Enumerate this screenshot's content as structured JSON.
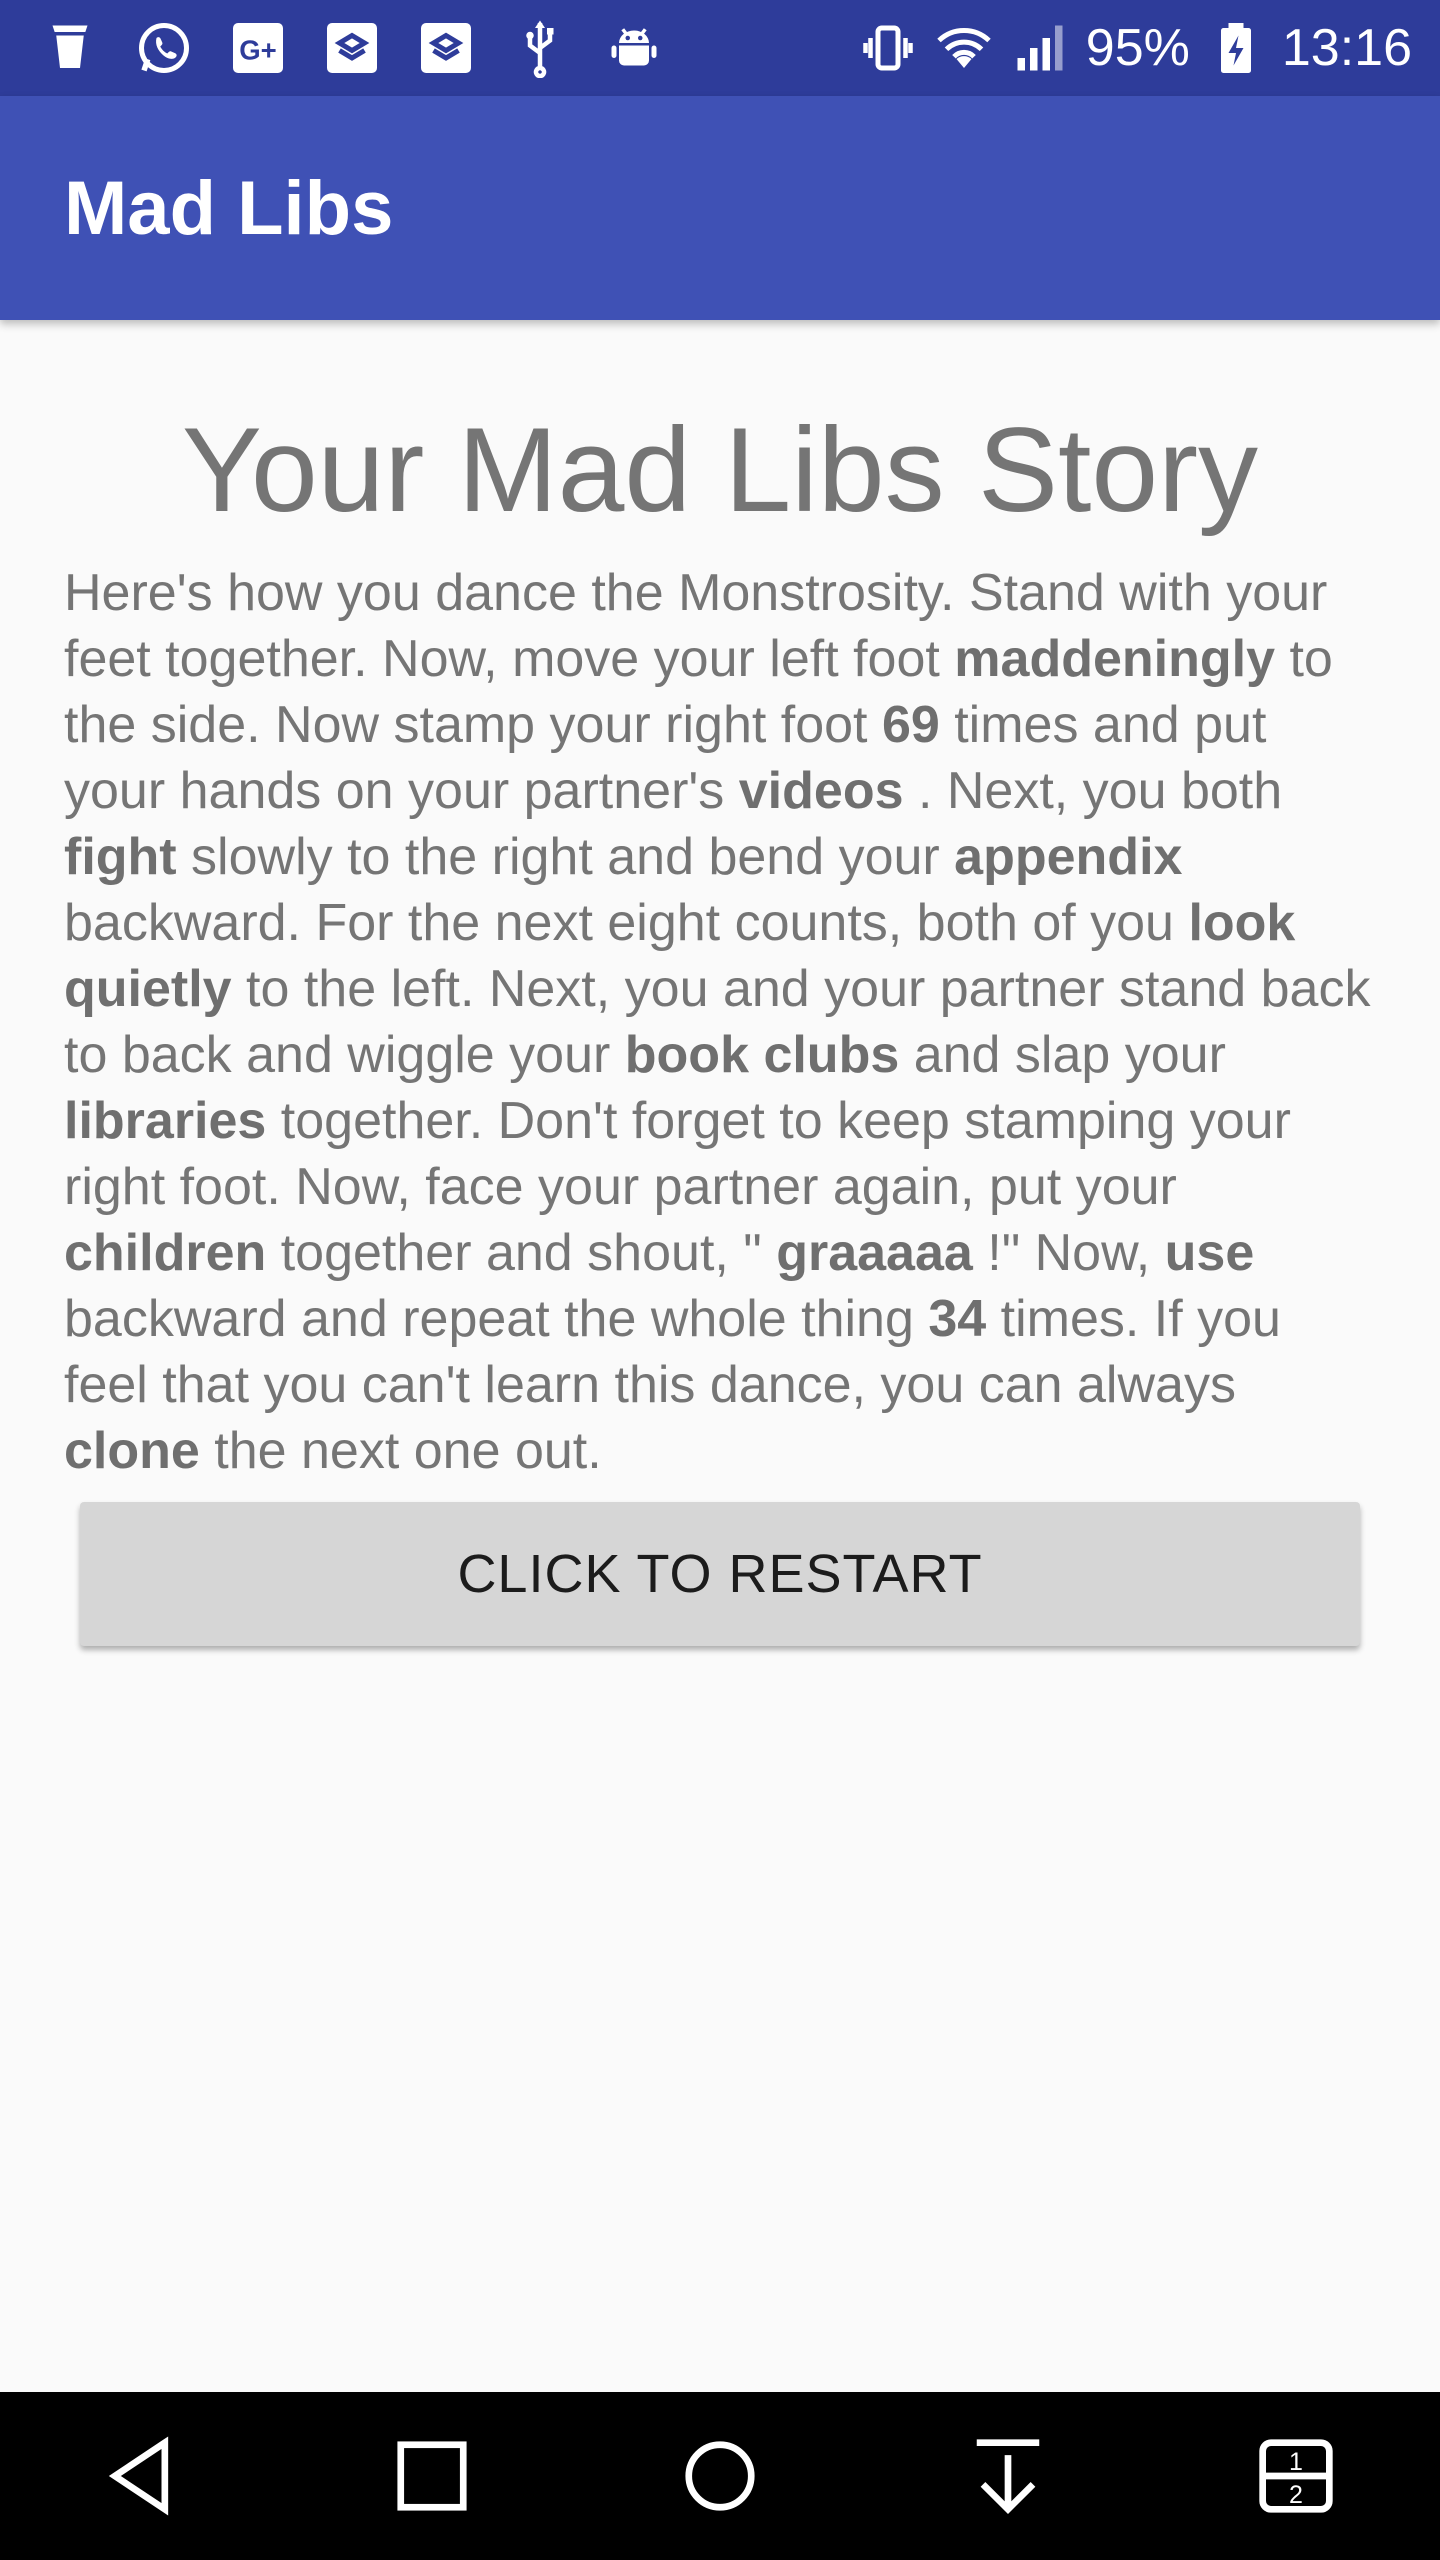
{
  "status_bar": {
    "battery": "95%",
    "time": "13:16",
    "icons_left": [
      "notification-cup-icon",
      "whatsapp-icon",
      "google-plus-icon",
      "shopping-bag-icon",
      "shopping-bag-icon",
      "usb-icon",
      "android-icon"
    ],
    "icons_right": [
      "vibrate-icon",
      "wifi-icon",
      "cell-signal-icon",
      "battery-charging-icon"
    ]
  },
  "app_bar": {
    "title": "Mad Libs"
  },
  "story": {
    "heading": "Your Mad Libs Story",
    "segments": [
      {
        "text": "Here's how you dance the Monstrosity. Stand with your feet together. Now, move your left foot ",
        "bold": false
      },
      {
        "text": "maddeningly",
        "bold": true
      },
      {
        "text": " to the side. Now stamp your right foot ",
        "bold": false
      },
      {
        "text": "69",
        "bold": true
      },
      {
        "text": " times and put your hands on your partner's ",
        "bold": false
      },
      {
        "text": "videos",
        "bold": true
      },
      {
        "text": " . Next, you both ",
        "bold": false
      },
      {
        "text": "fight",
        "bold": true
      },
      {
        "text": " slowly to the right and bend your ",
        "bold": false
      },
      {
        "text": "appendix",
        "bold": true
      },
      {
        "text": " backward. For the next eight counts, both of you ",
        "bold": false
      },
      {
        "text": "look quietly",
        "bold": true
      },
      {
        "text": " to the left. Next, you and your partner stand back to back and wiggle your ",
        "bold": false
      },
      {
        "text": "book clubs",
        "bold": true
      },
      {
        "text": " and slap your ",
        "bold": false
      },
      {
        "text": "libraries",
        "bold": true
      },
      {
        "text": " together. Don't forget to keep stamping your right foot. Now, face your partner again, put your ",
        "bold": false
      },
      {
        "text": "children",
        "bold": true
      },
      {
        "text": " together and shout, \" ",
        "bold": false
      },
      {
        "text": "graaaaa",
        "bold": true
      },
      {
        "text": " !\" Now, ",
        "bold": false
      },
      {
        "text": "use",
        "bold": true
      },
      {
        "text": " backward and repeat the whole thing ",
        "bold": false
      },
      {
        "text": "34",
        "bold": true
      },
      {
        "text": " times. If you feel that you can't learn this dance, you can always ",
        "bold": false
      },
      {
        "text": "clone",
        "bold": true
      },
      {
        "text": " the next one out.",
        "bold": false
      }
    ]
  },
  "restart_button": {
    "label": "CLICK TO RESTART"
  },
  "nav_bar": {
    "buttons": [
      "back-icon",
      "recents-icon",
      "home-icon",
      "notification-pull-down-icon",
      "split-screen-icon"
    ]
  },
  "colors": {
    "status_bar": "#2e3c9a",
    "app_bar": "#3f51b5",
    "background": "#fafafa",
    "story_text": "#757575",
    "button": "#d6d6d6",
    "nav_bar": "#000000"
  }
}
